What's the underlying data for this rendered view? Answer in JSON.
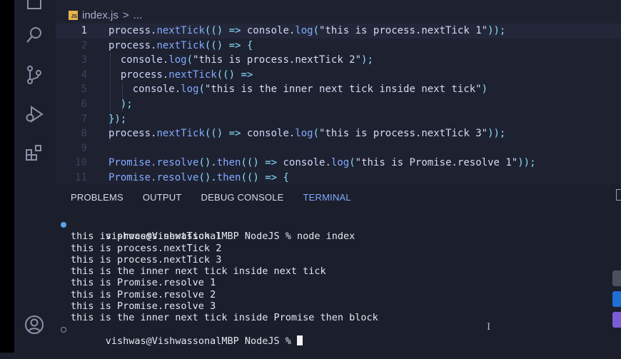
{
  "activity_bar": {
    "icons": [
      "explorer-icon",
      "search-icon",
      "source-control-icon",
      "run-debug-icon",
      "extensions-icon",
      "account-icon"
    ]
  },
  "breadcrumb": {
    "file_badge": "JS",
    "file_name": "index.js",
    "separator": ">",
    "more": "..."
  },
  "editor": {
    "lines": [
      {
        "n": "1",
        "indent": "",
        "tokens": [
          [
            "process.",
            "base"
          ],
          [
            "nextTick",
            "fn"
          ],
          [
            "(() ",
            "punc"
          ],
          [
            "=>",
            "op"
          ],
          [
            " console.",
            "base"
          ],
          [
            "log",
            "fn"
          ],
          [
            "(",
            "punc"
          ],
          [
            "\"this is process.nextTick 1\"",
            "str"
          ],
          [
            "));",
            "punc"
          ]
        ]
      },
      {
        "n": "2",
        "indent": "",
        "tokens": [
          [
            "process.",
            "base"
          ],
          [
            "nextTick",
            "fn"
          ],
          [
            "(() ",
            "punc"
          ],
          [
            "=>",
            "op"
          ],
          [
            " {",
            "punc"
          ]
        ]
      },
      {
        "n": "3",
        "indent": "  ",
        "tokens": [
          [
            "console.",
            "base"
          ],
          [
            "log",
            "fn"
          ],
          [
            "(",
            "punc"
          ],
          [
            "\"this is process.nextTick 2\"",
            "str"
          ],
          [
            ");",
            "punc"
          ]
        ]
      },
      {
        "n": "4",
        "indent": "  ",
        "tokens": [
          [
            "process.",
            "base"
          ],
          [
            "nextTick",
            "fn"
          ],
          [
            "(() ",
            "punc"
          ],
          [
            "=>",
            "op"
          ]
        ]
      },
      {
        "n": "5",
        "indent": "    ",
        "tokens": [
          [
            "console.",
            "base"
          ],
          [
            "log",
            "fn"
          ],
          [
            "(",
            "punc"
          ],
          [
            "\"this is the inner next tick inside next tick\"",
            "str"
          ],
          [
            ")",
            "punc"
          ]
        ]
      },
      {
        "n": "6",
        "indent": "  ",
        "tokens": [
          [
            ");",
            "punc"
          ]
        ]
      },
      {
        "n": "7",
        "indent": "",
        "tokens": [
          [
            "});",
            "punc"
          ]
        ]
      },
      {
        "n": "8",
        "indent": "",
        "tokens": [
          [
            "process.",
            "base"
          ],
          [
            "nextTick",
            "fn"
          ],
          [
            "(() ",
            "punc"
          ],
          [
            "=>",
            "op"
          ],
          [
            " console.",
            "base"
          ],
          [
            "log",
            "fn"
          ],
          [
            "(",
            "punc"
          ],
          [
            "\"this is process.nextTick 3\"",
            "str"
          ],
          [
            "));",
            "punc"
          ]
        ]
      },
      {
        "n": "9",
        "indent": "",
        "tokens": []
      },
      {
        "n": "10",
        "indent": "",
        "tokens": [
          [
            "Promise.",
            "fn"
          ],
          [
            "resolve",
            "fn"
          ],
          [
            "().",
            "punc"
          ],
          [
            "then",
            "fn"
          ],
          [
            "(() ",
            "punc"
          ],
          [
            "=>",
            "op"
          ],
          [
            " console.",
            "base"
          ],
          [
            "log",
            "fn"
          ],
          [
            "(",
            "punc"
          ],
          [
            "\"this is Promise.resolve 1\"",
            "str"
          ],
          [
            "));",
            "punc"
          ]
        ]
      },
      {
        "n": "11",
        "indent": "",
        "tokens": [
          [
            "Promise.",
            "fn"
          ],
          [
            "resolve",
            "fn"
          ],
          [
            "().",
            "punc"
          ],
          [
            "then",
            "fn"
          ],
          [
            "(() ",
            "punc"
          ],
          [
            "=>",
            "op"
          ],
          [
            " {",
            "punc"
          ]
        ]
      }
    ]
  },
  "panel": {
    "tabs": [
      "PROBLEMS",
      "OUTPUT",
      "DEBUG CONSOLE",
      "TERMINAL"
    ],
    "active_tab": "TERMINAL"
  },
  "terminal": {
    "prompt_command": "vishwas@VishwassonalMBP NodeJS % node index",
    "output": [
      "this is process.nextTick 1",
      "this is process.nextTick 2",
      "this is process.nextTick 3",
      "this is the inner next tick inside next tick",
      "this is Promise.resolve 1",
      "this is Promise.resolve 2",
      "this is Promise.resolve 3",
      "this is the inner next tick inside Promise then block"
    ],
    "prompt_current": "vishwas@VishwassonalMBP NodeJS % "
  },
  "colors": {
    "accent": "#82aaff",
    "status_dot": "#5aa2e8",
    "js_badge": "#e8b44c"
  }
}
